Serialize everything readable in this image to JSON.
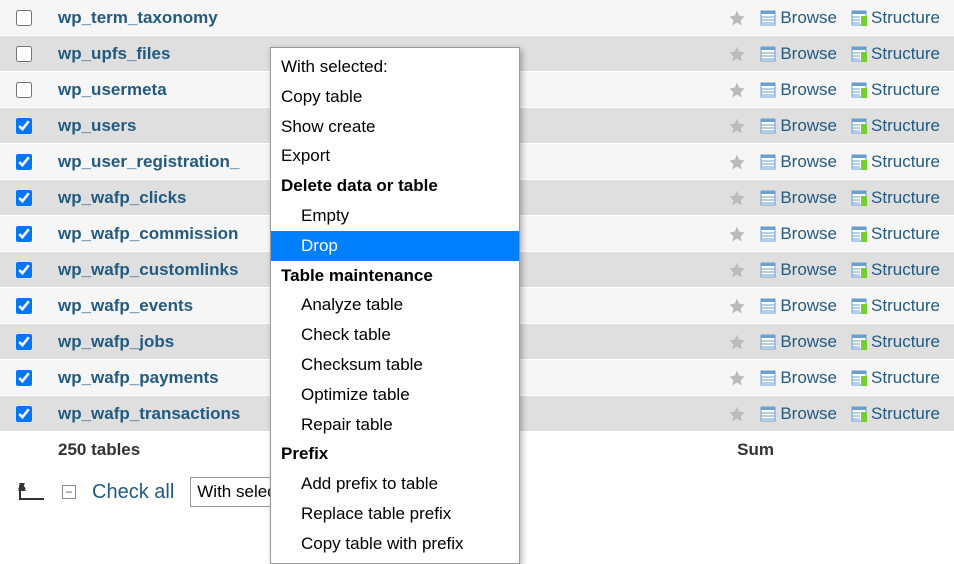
{
  "tables": [
    {
      "name": "wp_term_taxonomy",
      "checked": false,
      "odd": true
    },
    {
      "name": "wp_upfs_files",
      "checked": false,
      "odd": false
    },
    {
      "name": "wp_usermeta",
      "checked": false,
      "odd": true
    },
    {
      "name": "wp_users",
      "checked": true,
      "odd": false
    },
    {
      "name": "wp_user_registration_",
      "checked": true,
      "odd": true
    },
    {
      "name": "wp_wafp_clicks",
      "checked": true,
      "odd": false
    },
    {
      "name": "wp_wafp_commission",
      "checked": true,
      "odd": true
    },
    {
      "name": "wp_wafp_customlinks",
      "checked": true,
      "odd": false
    },
    {
      "name": "wp_wafp_events",
      "checked": true,
      "odd": true
    },
    {
      "name": "wp_wafp_jobs",
      "checked": true,
      "odd": false
    },
    {
      "name": "wp_wafp_payments",
      "checked": true,
      "odd": true
    },
    {
      "name": "wp_wafp_transactions",
      "checked": true,
      "odd": false
    }
  ],
  "actions": {
    "browse": "Browse",
    "structure": "Structure"
  },
  "summary": {
    "count": "250 tables",
    "sum": "Sum"
  },
  "bottom": {
    "check_all": "Check all",
    "with_selected": "With selected:"
  },
  "context_menu": {
    "header1": "With selected:",
    "copy_table": "Copy table",
    "show_create": "Show create",
    "export": "Export",
    "header2": "Delete data or table",
    "empty": "Empty",
    "drop": "Drop",
    "header3": "Table maintenance",
    "analyze": "Analyze table",
    "check": "Check table",
    "checksum": "Checksum table",
    "optimize": "Optimize table",
    "repair": "Repair table",
    "header4": "Prefix",
    "add_prefix": "Add prefix to table",
    "replace_prefix": "Replace table prefix",
    "copy_prefix": "Copy table with prefix"
  }
}
